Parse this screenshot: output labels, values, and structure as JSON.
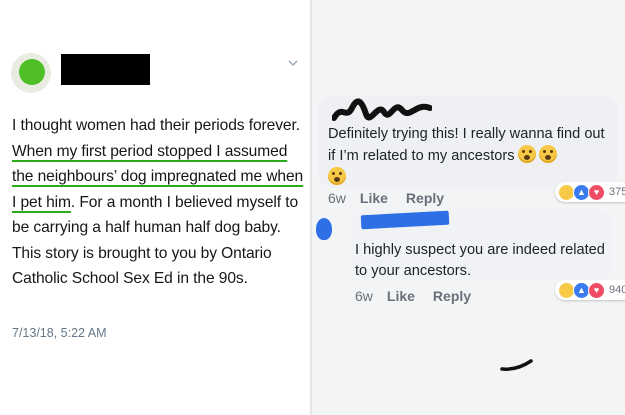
{
  "tweet": {
    "text_before": "I thought women had their periods forever. ",
    "text_underlined": "When my first period stopped I assumed the neighbours’ dog impregnated me when I pet him",
    "text_after": ". For a month I believed myself to be carrying a half human half dog baby. This story is brought to you by Ontario Catholic School Sex Ed in the 90s.",
    "date": "7/13/18, 5:22 AM",
    "icons": {
      "menu": "chevron-down-icon",
      "avatar": "avatar"
    }
  },
  "comments": [
    {
      "text": "Definitely trying this! I really wanna find out if I’m related to my ancestors",
      "time": "6w",
      "like_label": "Like",
      "reply_label": "Reply",
      "reaction_count": "375",
      "reactions": [
        "haha",
        "like",
        "love"
      ]
    },
    {
      "text": "I highly suspect you are indeed related to your ancestors.",
      "time": "6w",
      "like_label": "Like",
      "reply_label": "Reply",
      "reaction_count": "940",
      "reactions": [
        "haha",
        "like",
        "love"
      ]
    }
  ],
  "colors": {
    "underline_green": "#2da91c",
    "redaction_blue": "#2f6fe6",
    "avatar_green": "#4fbf25"
  }
}
